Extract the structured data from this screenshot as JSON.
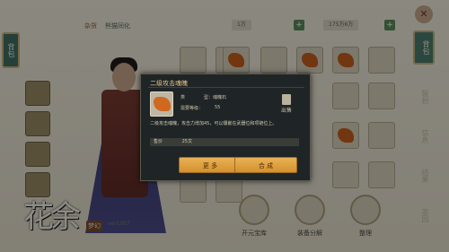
{
  "top": {
    "tab_1": "杂货",
    "tab_2": "熊猫同化",
    "currency_1": "1万",
    "currency_2": "175万6万"
  },
  "left_tab": "背包",
  "right_tab": "背包",
  "side_menu": [
    "装扮",
    "信息",
    "结果",
    "家园"
  ],
  "logo": {
    "main": "花余",
    "badge": "梦幻",
    "version": "ver1007"
  },
  "bottom": {
    "btn_1": "开元宝库",
    "btn_2": "装备分解",
    "btn_3": "整理"
  },
  "modal": {
    "title": "二级攻击魂魄",
    "type_label": "类",
    "type_value": "型：魂魄石",
    "level_label": "需要等级：",
    "level_value": "55",
    "sell_label": "出售",
    "description": "二级攻击魂魄，攻击力增加45，可以镶嵌在武器位和项链位上。",
    "price_label": "售价",
    "price_value": "25文",
    "more_button": "更 多",
    "combine_button": "合 成"
  }
}
